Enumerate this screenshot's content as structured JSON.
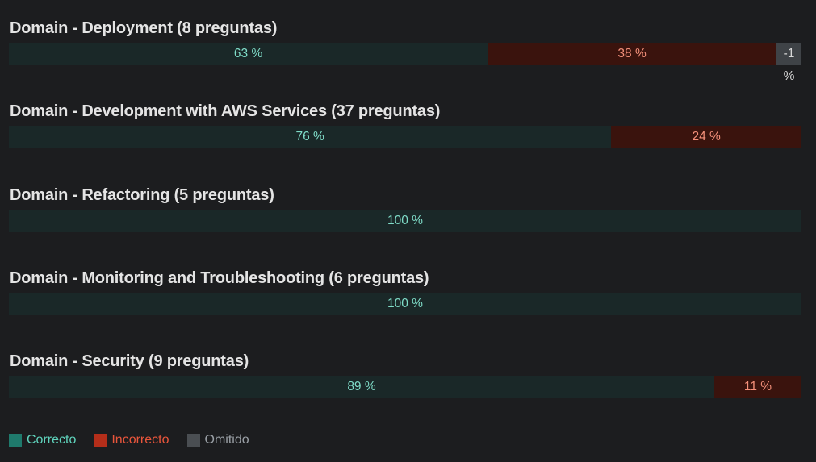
{
  "chart_data": {
    "type": "bar",
    "orientation": "horizontal-stacked-100",
    "categories": [
      "Domain - Deployment (8 preguntas)",
      "Domain - Development with AWS Services (37 preguntas)",
      "Domain - Refactoring (5 preguntas)",
      "Domain - Monitoring and Troubleshooting (6 preguntas)",
      "Domain - Security (9 preguntas)"
    ],
    "series": [
      {
        "name": "Correcto",
        "values": [
          63,
          76,
          100,
          100,
          89
        ],
        "labels": [
          "63 %",
          "76 %",
          "100 %",
          "100 %",
          "89 %"
        ],
        "color": "#1f7a6c"
      },
      {
        "name": "Incorrecto",
        "values": [
          38,
          24,
          0,
          0,
          11
        ],
        "labels": [
          "38 %",
          "24 %",
          "",
          "",
          "11 %"
        ],
        "color": "#b42e1a"
      },
      {
        "name": "Omitido",
        "values": [
          -1,
          0,
          0,
          0,
          0
        ],
        "labels": [
          "-1 %",
          "",
          "",
          "",
          ""
        ],
        "color": "#4a4e52"
      }
    ],
    "omitted_display": {
      "value": "-1",
      "unit": "%"
    },
    "legend": {
      "placement": "bottom-left"
    },
    "grid": false
  }
}
